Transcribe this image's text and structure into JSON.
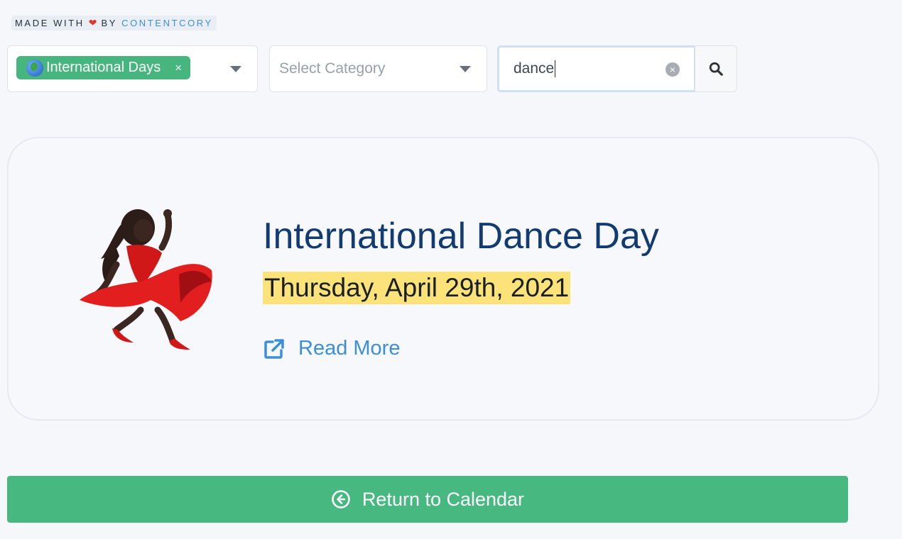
{
  "credit": {
    "prefix": "MADE WITH",
    "heart": "❤",
    "by": "BY",
    "brand": "CONTENTCORY"
  },
  "filters": {
    "type_tag": "International Days",
    "type_tag_remove": "×",
    "category_placeholder": "Select Category",
    "search_value": "dance",
    "search_clear": "×"
  },
  "result": {
    "title": "International Dance Day",
    "date": "Thursday, April 29th, 2021",
    "read_more": "Read More",
    "image_icon": "woman-dancing-emoji"
  },
  "footer": {
    "return_label": "Return to Calendar"
  },
  "colors": {
    "accent_green": "#46b880",
    "title_blue": "#123b71",
    "link_blue": "#3a8fd8",
    "date_highlight": "#fbe37a"
  }
}
